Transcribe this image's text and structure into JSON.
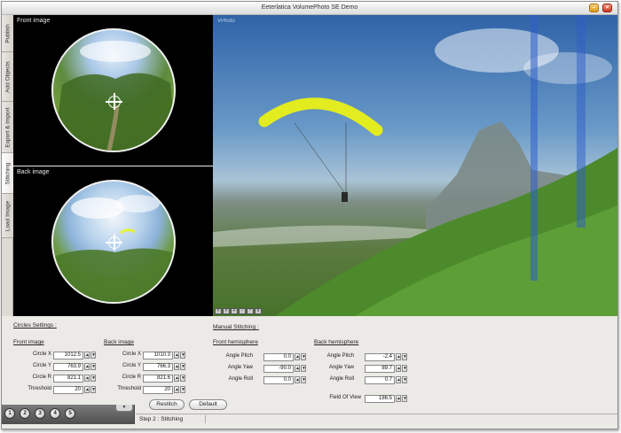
{
  "window": {
    "title": "Eeterlatica VolumePhoto SE Demo"
  },
  "side_tabs": [
    "Publish",
    "Add Objects",
    "Export & Import",
    "Stitching",
    "Load Image"
  ],
  "panels": {
    "front_label": "Front image",
    "back_label": "Back image",
    "viewer_label": "VPhoto"
  },
  "viewer_nav": [
    "<",
    ">",
    "+",
    "-",
    "^",
    "v"
  ],
  "circles": {
    "title": "Circles Settings :",
    "front": {
      "heading": "Front image",
      "circle_x_label": "Circle X",
      "circle_x": "1012.5",
      "circle_y_label": "Circle Y",
      "circle_y": "763.9",
      "circle_r_label": "Circle R",
      "circle_r": "821.1",
      "threshold_label": "Threshold",
      "threshold": "20"
    },
    "back": {
      "heading": "Back image",
      "circle_x_label": "Circle X",
      "circle_x": "1010.3",
      "circle_y_label": "Circle Y",
      "circle_y": "766.3",
      "circle_r_label": "Circle R",
      "circle_r": "821.6",
      "threshold_label": "Threshold",
      "threshold": "20"
    }
  },
  "manual": {
    "title": "Manual Stitching :",
    "front": {
      "heading": "Front hemisphere",
      "pitch_label": "Angle Pitch",
      "pitch": "0.0",
      "yaw_label": "Angle Yaw",
      "yaw": "-90.0",
      "roll_label": "Angle Roll",
      "roll": "0.0"
    },
    "back": {
      "heading": "Back hemisphere",
      "pitch_label": "Angle Pitch",
      "pitch": "-2.4",
      "yaw_label": "Angle Yaw",
      "yaw": "89.7",
      "roll_label": "Angle Roll",
      "roll": "0.7"
    },
    "fov_label": "Field Of View",
    "fov": "186.5"
  },
  "buttons": {
    "restitch": "Restitch",
    "default": "Default"
  },
  "steps": [
    "1",
    "2",
    "3",
    "4",
    "5"
  ],
  "status": {
    "text": "Step 2 : Stitching"
  },
  "icons": {
    "minimize": "minimize-icon",
    "close": "close-icon",
    "crosshair": "crosshair-icon"
  }
}
